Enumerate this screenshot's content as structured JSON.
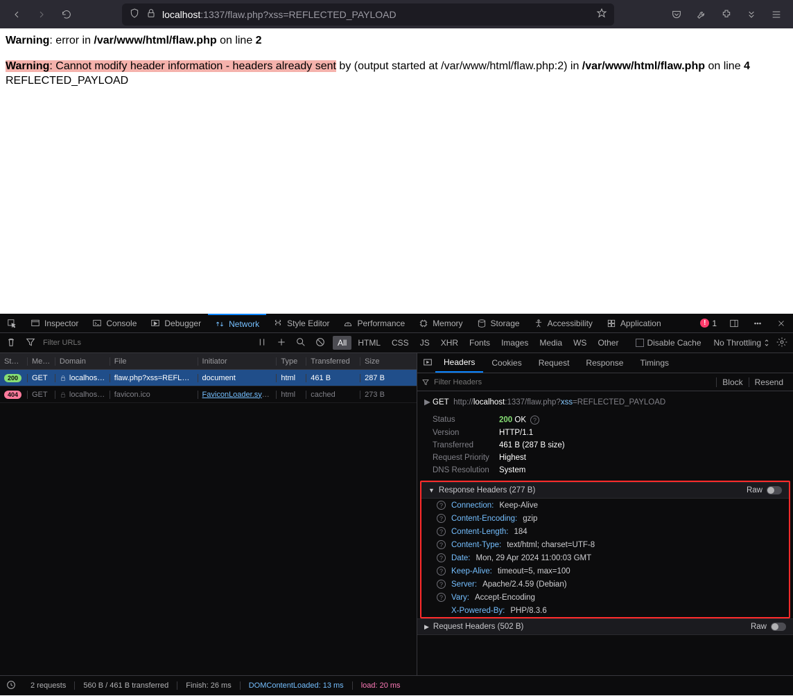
{
  "chrome": {
    "url_host": "localhost",
    "url_rest": ":1337/flaw.php?xss=REFLECTED_PAYLOAD"
  },
  "page": {
    "w1_a": "Warning",
    "w1_b": ": error in ",
    "w1_c": "/var/www/html/flaw.php",
    "w1_d": " on line ",
    "w1_e": "2",
    "w2_a": "Warning",
    "w2_b": ": Cannot modify header information - headers already sent",
    "w2_c": " by (output started at /var/www/html/flaw.php:2) in ",
    "w2_d": "/var/www/html/flaw.php",
    "w2_e": " on line ",
    "w2_f": "4",
    "w2_g": "REFLECTED_PAYLOAD"
  },
  "dtabs": {
    "inspector": "Inspector",
    "console": "Console",
    "debugger": "Debugger",
    "network": "Network",
    "style": "Style Editor",
    "perf": "Performance",
    "memory": "Memory",
    "storage": "Storage",
    "a11y": "Accessibility",
    "app": "Application",
    "err": "1"
  },
  "netbar": {
    "filter_ph": "Filter URLs",
    "all": "All",
    "html": "HTML",
    "css": "CSS",
    "js": "JS",
    "xhr": "XHR",
    "fonts": "Fonts",
    "images": "Images",
    "media": "Media",
    "ws": "WS",
    "other": "Other",
    "cache": "Disable Cache",
    "throttle": "No Throttling"
  },
  "cols": {
    "s": "Status",
    "m": "Me…",
    "d": "Domain",
    "f": "File",
    "i": "Initiator",
    "t": "Type",
    "x": "Transferred",
    "z": "Size"
  },
  "rows": [
    {
      "s": "200",
      "m": "GET",
      "d": "localhos…",
      "f": "flaw.php?xss=REFLECTE",
      "i": "document",
      "t": "html",
      "x": "461 B",
      "z": "287 B",
      "sel": true
    },
    {
      "s": "404",
      "m": "GET",
      "d": "localhos…",
      "f": "favicon.ico",
      "i": "FaviconLoader.sys.…",
      "t": "html",
      "x": "cached",
      "z": "273 B",
      "sel": false
    }
  ],
  "detail": {
    "tabs": {
      "headers": "Headers",
      "cookies": "Cookies",
      "request": "Request",
      "response": "Response",
      "timings": "Timings"
    },
    "filter_ph": "Filter Headers",
    "block": "Block",
    "resend": "Resend",
    "method": "GET",
    "u1": "http://",
    "u2": "localhost",
    "u3": ":1337/flaw.php?",
    "u4": "xss",
    "u5": "=REFLECTED_PAYLOAD",
    "summary": [
      {
        "k": "Status",
        "v": "OK",
        "code": "200",
        "q": true
      },
      {
        "k": "Version",
        "v": "HTTP/1.1"
      },
      {
        "k": "Transferred",
        "v": "461 B (287 B size)"
      },
      {
        "k": "Request Priority",
        "v": "Highest"
      },
      {
        "k": "DNS Resolution",
        "v": "System"
      }
    ],
    "resp_h_title": "Response Headers (277 B)",
    "raw": "Raw",
    "resp_headers": [
      {
        "k": "Connection:",
        "v": "Keep-Alive"
      },
      {
        "k": "Content-Encoding:",
        "v": "gzip"
      },
      {
        "k": "Content-Length:",
        "v": "184"
      },
      {
        "k": "Content-Type:",
        "v": "text/html; charset=UTF-8"
      },
      {
        "k": "Date:",
        "v": "Mon, 29 Apr 2024 11:00:03 GMT"
      },
      {
        "k": "Keep-Alive:",
        "v": "timeout=5, max=100"
      },
      {
        "k": "Server:",
        "v": "Apache/2.4.59 (Debian)"
      },
      {
        "k": "Vary:",
        "v": "Accept-Encoding"
      },
      {
        "k": "X-Powered-By:",
        "v": "PHP/8.3.6"
      }
    ],
    "req_h_title": "Request Headers (502 B)"
  },
  "status": {
    "reqs": "2 requests",
    "xfer": "560 B / 461 B transferred",
    "finish": "Finish: 26 ms",
    "dcl": "DOMContentLoaded: 13 ms",
    "load": "load: 20 ms"
  }
}
